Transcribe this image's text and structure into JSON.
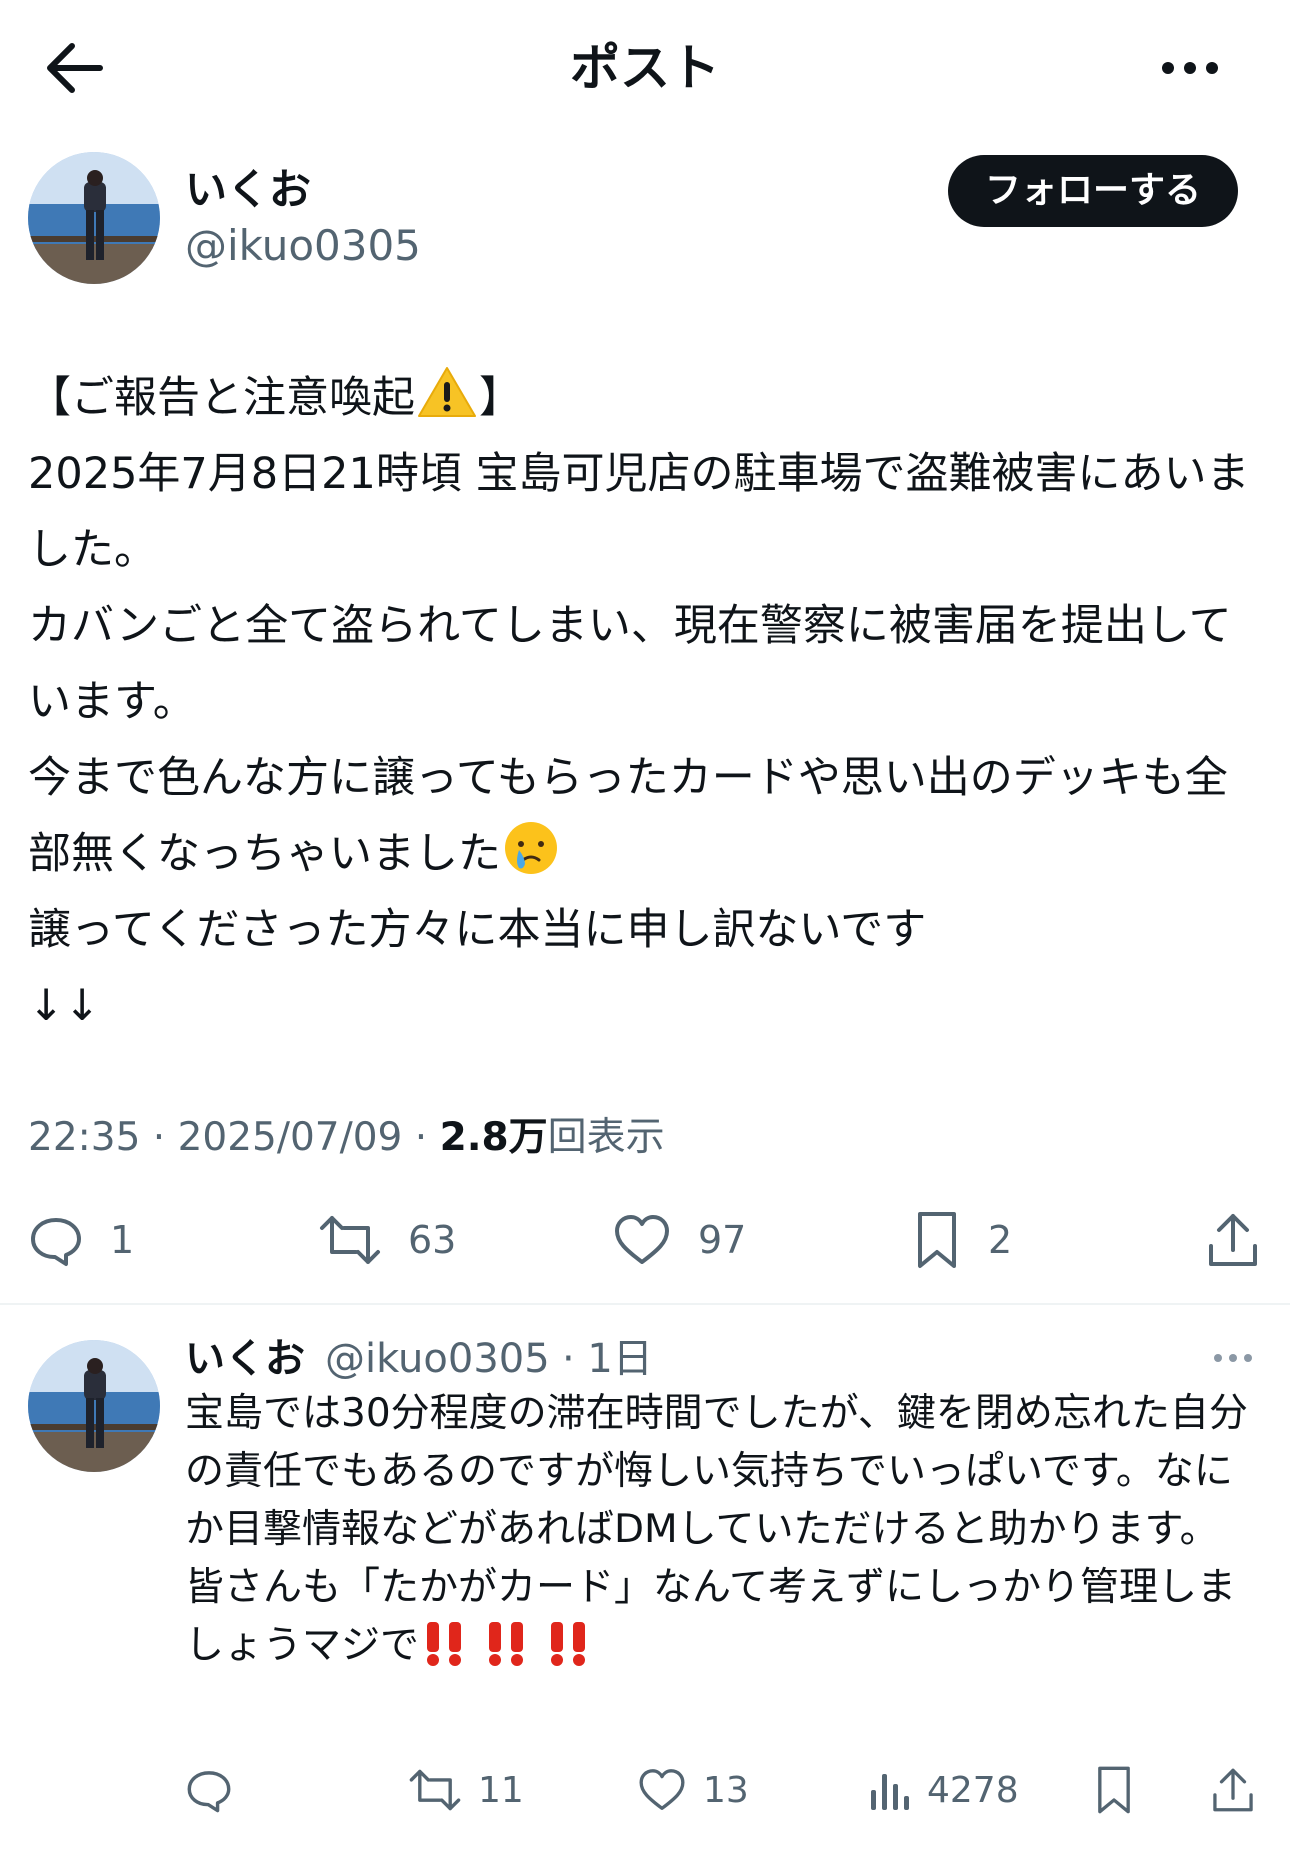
{
  "header": {
    "title": "ポスト"
  },
  "post": {
    "author_name": "いくお",
    "author_handle": "@ikuo0305",
    "follow_label": "フォローする",
    "text_line1_pre": "【ご報告と注意喚起",
    "text_line1_post": "】",
    "text_body_a": "2025年7月8日21時頃 宝島可児店の駐車場で盗難被害にあいました。\nカバンごと全て盗られてしまい、現在警察に被害届を提出しています。\n今まで色んな方に譲ってもらったカードや思い出のデッキも全部無くなっちゃいました",
    "text_body_b": "\n譲ってくださった方々に本当に申し訳ないです\n↓↓",
    "time": "22:35 · 2025/07/09 · ",
    "views_number": "2.8万",
    "views_label": "回表示",
    "counts": {
      "replies": "1",
      "reposts": "63",
      "likes": "97",
      "bookmarks": "2"
    }
  },
  "reply": {
    "author_name": "いくお",
    "author_handle": "@ikuo0305",
    "time": "· 1日",
    "text_main": "宝島では30分程度の滞在時間でしたが、鍵を閉め忘れた自分の責任でもあるのですが悔しい気持ちでいっぱいです。なにか目撃情報などがあればDMしていただけると助かります。\n皆さんも「たかがカード」なんて考えずにしっかり管理しましょうマジで",
    "counts": {
      "reposts": "11",
      "likes": "13",
      "views": "4278"
    }
  },
  "colors": {
    "text_primary": "#0f1419",
    "text_secondary": "#536471",
    "divider": "#eff3f4"
  }
}
